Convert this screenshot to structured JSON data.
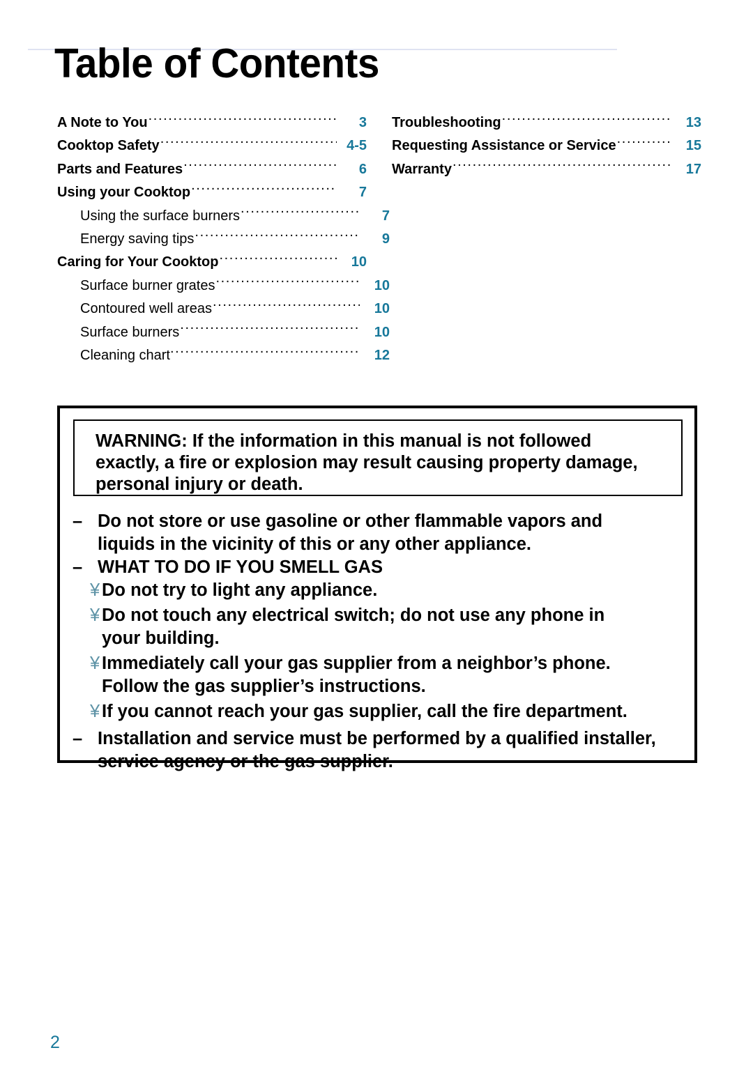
{
  "page": {
    "title": "Table of Contents",
    "folio": "2",
    "accent_color": "#17789a",
    "bullet_glyph_color": "#5e93a6"
  },
  "toc": {
    "left_column": [
      {
        "label": "A Note to You",
        "page": "3",
        "level": "main"
      },
      {
        "label": "Cooktop Safety",
        "page": "4-5",
        "level": "main"
      },
      {
        "label": "Parts and Features",
        "page": "6",
        "level": "main"
      },
      {
        "label": "Using your Cooktop",
        "page": "7",
        "level": "main"
      },
      {
        "label": "Using the surface burners",
        "page": "7",
        "level": "sub"
      },
      {
        "label": "Energy saving tips",
        "page": "9",
        "level": "sub"
      },
      {
        "label": "Caring for Your Cooktop",
        "page": "10",
        "level": "main"
      },
      {
        "label": "Surface burner grates",
        "page": "10",
        "level": "sub"
      },
      {
        "label": "Contoured well areas",
        "page": "10",
        "level": "sub"
      },
      {
        "label": "Surface burners",
        "page": "10",
        "level": "sub"
      },
      {
        "label": "Cleaning chart",
        "page": "12",
        "level": "sub"
      }
    ],
    "right_column": [
      {
        "label": "Troubleshooting",
        "page": "13",
        "level": "main"
      },
      {
        "label": "Requesting Assistance or Service",
        "page": "15",
        "level": "main"
      },
      {
        "label": "Warranty",
        "page": "17",
        "level": "main"
      }
    ]
  },
  "warning": {
    "headline_line1": "WARNING: If the information in this manual is not followed",
    "headline_line2": "exactly, a fire or explosion may result causing property damage,",
    "headline_line3": "personal injury or death.",
    "dash": "–",
    "bullet_glyph": "¥",
    "items": [
      {
        "type": "dash",
        "line1": "Do not store or use gasoline or other flammable vapors and",
        "line2": "liquids in the vicinity of this or any other appliance."
      },
      {
        "type": "dash",
        "line1": "WHAT TO DO IF YOU SMELL GAS"
      },
      {
        "type": "bullet",
        "line1": "Do not try to light any appliance."
      },
      {
        "type": "bullet",
        "line1": "Do not touch any electrical switch; do not use any phone in",
        "line2": "your building."
      },
      {
        "type": "bullet",
        "line1": "Immediately call your gas supplier from a neighbor’s phone.",
        "line2": "Follow the gas supplier’s instructions."
      },
      {
        "type": "bullet",
        "line1": "If you cannot reach your gas supplier, call the fire department."
      },
      {
        "type": "dash",
        "line1": "Installation and service must be performed by a qualified installer,",
        "line2": "service agency or the gas supplier."
      }
    ]
  }
}
